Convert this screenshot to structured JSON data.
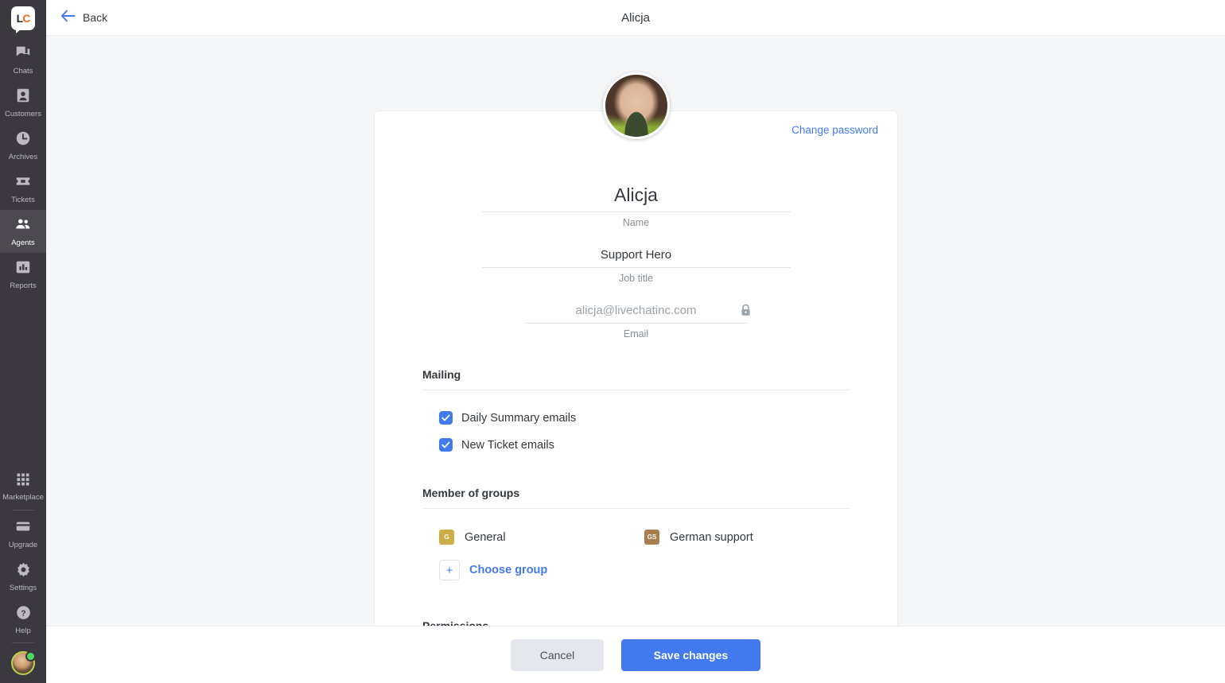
{
  "app": {
    "logo_left": "L",
    "logo_right": "C",
    "logo_name": "livechat-logo"
  },
  "sidebar": {
    "items": [
      {
        "label": "Chats",
        "icon": "chats-icon",
        "active": false
      },
      {
        "label": "Customers",
        "icon": "customers-icon",
        "active": false
      },
      {
        "label": "Archives",
        "icon": "archives-icon",
        "active": false
      },
      {
        "label": "Tickets",
        "icon": "tickets-icon",
        "active": false
      },
      {
        "label": "Agents",
        "icon": "agents-icon",
        "active": true
      },
      {
        "label": "Reports",
        "icon": "reports-icon",
        "active": false
      }
    ],
    "bottom_items": [
      {
        "label": "Marketplace",
        "icon": "marketplace-icon"
      },
      {
        "label": "Upgrade",
        "icon": "upgrade-icon"
      },
      {
        "label": "Settings",
        "icon": "settings-icon"
      },
      {
        "label": "Help",
        "icon": "help-icon"
      }
    ],
    "avatar": {
      "name": "user-avatar",
      "status": "online"
    }
  },
  "header": {
    "back_label": "Back",
    "title": "Alicja"
  },
  "profile": {
    "change_password_label": "Change password",
    "fields": [
      {
        "value": "Alicja",
        "label": "Name",
        "placeholder": "Name",
        "locked": false
      },
      {
        "value": "Support Hero",
        "label": "Job title",
        "placeholder": "Job title",
        "locked": false
      },
      {
        "value": "alicja@livechatinc.com",
        "label": "Email",
        "placeholder": "Email",
        "locked": true
      }
    ]
  },
  "mailing": {
    "title": "Mailing",
    "options": [
      {
        "label": "Daily Summary emails",
        "checked": true
      },
      {
        "label": "New Ticket emails",
        "checked": true
      }
    ]
  },
  "groups": {
    "title": "Member of groups",
    "items": [
      {
        "initials": "G",
        "name": "General",
        "color": "#ccad48"
      },
      {
        "initials": "GS",
        "name": "German support",
        "color": "#a97f50"
      }
    ],
    "add_symbol": "+",
    "choose_label": "Choose group"
  },
  "permissions": {
    "title": "Permissions"
  },
  "footer": {
    "cancel_label": "Cancel",
    "save_label": "Save changes"
  },
  "colors": {
    "accent": "#4379ef",
    "sidebar": "#3b383f",
    "sidebar_active": "#4c4951",
    "page_bg": "#f5f6f8"
  }
}
